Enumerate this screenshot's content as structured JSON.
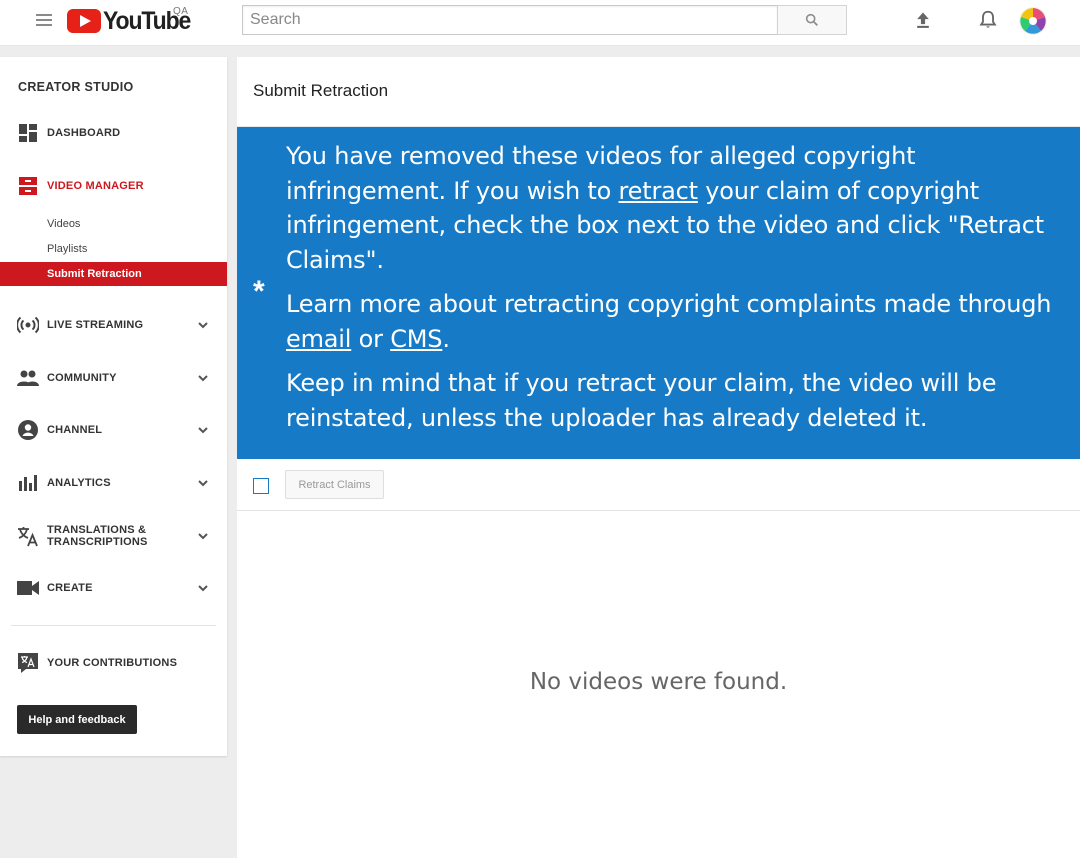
{
  "masthead": {
    "logo_text": "YouTube",
    "logo_badge": "QA",
    "search_placeholder": "Search",
    "icons": [
      "menu-icon",
      "search-icon",
      "upload-icon",
      "bell-icon",
      "avatar"
    ]
  },
  "sidebar": {
    "title": "CREATOR STUDIO",
    "items": [
      {
        "label": "DASHBOARD",
        "icon": "dashboard-icon"
      },
      {
        "label": "VIDEO MANAGER",
        "icon": "video-manager-icon",
        "active": true
      },
      {
        "label": "LIVE STREAMING",
        "icon": "live-streaming-icon"
      },
      {
        "label": "COMMUNITY",
        "icon": "community-icon"
      },
      {
        "label": "CHANNEL",
        "icon": "channel-icon"
      },
      {
        "label": "ANALYTICS",
        "icon": "analytics-icon"
      },
      {
        "label": "TRANSLATIONS & TRANSCRIPTIONS",
        "line1": "TRANSLATIONS &",
        "line2": "TRANSCRIPTIONS",
        "icon": "translate-icon"
      },
      {
        "label": "CREATE",
        "icon": "camera-icon"
      }
    ],
    "sub_items": [
      {
        "label": "Videos"
      },
      {
        "label": "Playlists"
      },
      {
        "label": "Submit Retraction",
        "active": true
      }
    ],
    "contributions": "YOUR CONTRIBUTIONS",
    "help_label": "Help and feedback"
  },
  "content": {
    "page_title": "Submit Retraction",
    "notice": {
      "asterisk": "*",
      "p1_a": "You have removed these videos for alleged copyright infringement. If you wish to ",
      "p1_link": "retract",
      "p1_b": " your claim of copyright infringement, check the box next to the video and click \"Retract Claims\".",
      "p2_a": "Learn more about retracting copyright complaints made through ",
      "p2_link1": "email",
      "p2_mid": " or ",
      "p2_link2": "CMS",
      "p2_b": ".",
      "p3": "Keep in mind that if you retract your claim, the video will be reinstated, unless the uploader has already deleted it."
    },
    "retract_button": "Retract Claims",
    "empty_message": "No videos were found."
  },
  "colors": {
    "brand_red": "#cc181e",
    "notice_blue": "#167ac6"
  }
}
